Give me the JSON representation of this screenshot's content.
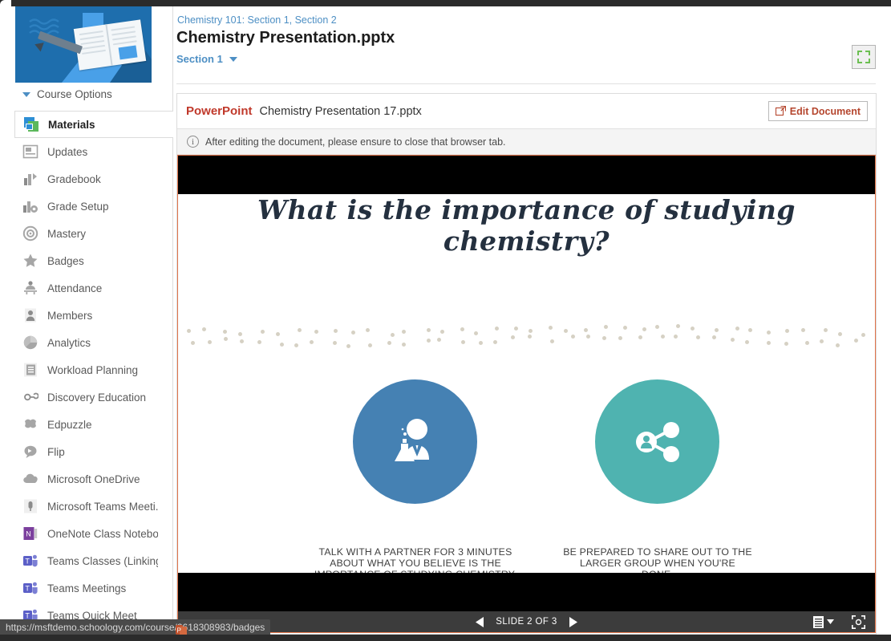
{
  "sidebar": {
    "course_image_alt": "course-banner",
    "course_options_label": "Course Options",
    "items": [
      {
        "label": "Materials",
        "icon": "materials-icon",
        "active": true
      },
      {
        "label": "Updates",
        "icon": "updates-icon",
        "active": false
      },
      {
        "label": "Gradebook",
        "icon": "gradebook-icon",
        "active": false
      },
      {
        "label": "Grade Setup",
        "icon": "grade-setup-icon",
        "active": false
      },
      {
        "label": "Mastery",
        "icon": "mastery-icon",
        "active": false
      },
      {
        "label": "Badges",
        "icon": "badges-star-icon",
        "active": false
      },
      {
        "label": "Attendance",
        "icon": "attendance-icon",
        "active": false
      },
      {
        "label": "Members",
        "icon": "members-person-icon",
        "active": false
      },
      {
        "label": "Analytics",
        "icon": "analytics-pie-icon",
        "active": false
      },
      {
        "label": "Workload Planning",
        "icon": "workload-planning-icon",
        "active": false
      },
      {
        "label": "Discovery Education",
        "icon": "discovery-education-icon",
        "active": false
      },
      {
        "label": "Edpuzzle",
        "icon": "edpuzzle-icon",
        "active": false
      },
      {
        "label": "Flip",
        "icon": "flip-icon",
        "active": false
      },
      {
        "label": "Microsoft OneDrive",
        "icon": "onedrive-cloud-icon",
        "active": false
      },
      {
        "label": "Microsoft Teams Meeti...",
        "icon": "teams-meeting-icon",
        "active": false
      },
      {
        "label": "OneNote Class Notebo...",
        "icon": "onenote-icon",
        "active": false
      },
      {
        "label": "Teams Classes (Linking)",
        "icon": "teams-icon",
        "active": false
      },
      {
        "label": "Teams Meetings",
        "icon": "teams-icon",
        "active": false
      },
      {
        "label": "Teams Quick Meet",
        "icon": "teams-icon",
        "active": false
      }
    ]
  },
  "header": {
    "breadcrumb": "Chemistry 101: Section 1, Section 2",
    "title": "Chemistry Presentation.pptx",
    "section_selector": "Section 1",
    "fullscreen_icon": "fullscreen-expand-icon"
  },
  "document": {
    "app_label": "PowerPoint",
    "file_name": "Chemistry Presentation 17.pptx",
    "edit_button": "Edit Document",
    "edit_button_icon": "external-link-icon",
    "notice_icon": "info-icon",
    "notice": "After editing the document, please ensure to close that browser tab."
  },
  "slide": {
    "title": "What is the importance of studying chemistry?",
    "left": {
      "icon": "chemist-scientist-icon",
      "circle_color": "#4581b3",
      "caption": "TALK WITH A PARTNER FOR 3 MINUTES ABOUT WHAT YOU BELIEVE IS THE IMPORTANCE OF STUDYING CHEMISTRY."
    },
    "right": {
      "icon": "share-network-icon",
      "circle_color": "#4fb3b0",
      "caption": "BE PREPARED TO SHARE OUT TO THE LARGER GROUP WHEN YOU'RE DONE."
    }
  },
  "viewer_toolbar": {
    "prev_icon": "previous-slide-icon",
    "next_icon": "next-slide-icon",
    "slide_counter": "SLIDE 2 OF 3",
    "notes_icon": "notes-menu-icon",
    "notes_caret_icon": "chevron-down-icon",
    "fit_icon": "fit-to-screen-icon"
  },
  "status_bar": {
    "url": "https://msftdemo.schoology.com/course/2618308983/badges",
    "cursor_icon": "powerpoint-cursor-icon"
  },
  "colors": {
    "link": "#4d8fc4",
    "powerpoint_red": "#c0392b",
    "slide_border": "#e0744a",
    "circle_blue": "#4581b3",
    "circle_teal": "#4fb3b0"
  }
}
